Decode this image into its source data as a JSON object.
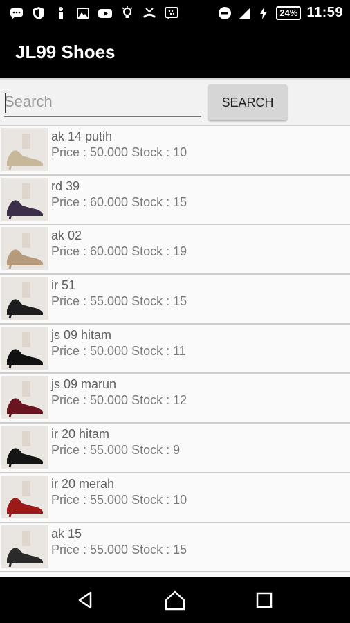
{
  "status_bar": {
    "battery": "24%",
    "time": "11:59",
    "icons": [
      "chat-icon",
      "shield-icon",
      "notification-icon",
      "image-icon",
      "youtube-icon",
      "bulb-icon",
      "missed-call-icon",
      "bbm-icon",
      "do-not-disturb-icon",
      "signal-icon",
      "charging-icon",
      "battery-icon"
    ]
  },
  "app_bar": {
    "title": "JL99 Shoes"
  },
  "search": {
    "placeholder": "Search",
    "button_label": "SEARCH"
  },
  "products": [
    {
      "name": "ak 14 putih",
      "price": "Price : 50.000 Stock : 10",
      "color": "#c8b89a"
    },
    {
      "name": "rd 39",
      "price": "Price : 60.000 Stock : 15",
      "color": "#3b2f4a"
    },
    {
      "name": "ak 02",
      "price": "Price : 60.000 Stock : 19",
      "color": "#b59a7c"
    },
    {
      "name": "ir 51",
      "price": "Price : 55.000 Stock : 15",
      "color": "#1d1d1d"
    },
    {
      "name": "js 09 hitam",
      "price": "Price : 50.000 Stock : 11",
      "color": "#111111"
    },
    {
      "name": "js 09 marun",
      "price": "Price : 50.000 Stock : 12",
      "color": "#6a1420"
    },
    {
      "name": "ir 20 hitam",
      "price": "Price : 55.000 Stock : 9",
      "color": "#151515"
    },
    {
      "name": "ir 20 merah",
      "price": "Price : 55.000 Stock : 10",
      "color": "#9c1a1a"
    },
    {
      "name": "ak 15",
      "price": "Price : 55.000 Stock : 15",
      "color": "#2a2a2a"
    }
  ],
  "nav_bar": {
    "icons": [
      "back-icon",
      "home-icon",
      "recents-icon"
    ]
  }
}
